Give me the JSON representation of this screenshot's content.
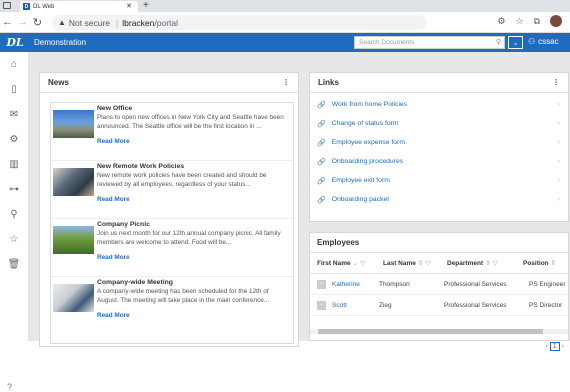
{
  "browser": {
    "tab_title": "DL Web",
    "url_warning": "Not secure",
    "url_host": "lbracken",
    "url_path": "/portal",
    "favicon_text": "D"
  },
  "app": {
    "logo": "DL",
    "title": "Demonstration",
    "search_placeholder": "Search Documents",
    "user": "cssac"
  },
  "news": {
    "title": "News",
    "items": [
      {
        "title": "New Office",
        "body": "Plans to open new offices in New York City and Seattle have been announced. The Seattle office will be the first location in ...",
        "link": "Read More"
      },
      {
        "title": "New Remote Work Policies",
        "body": "New remote work policies have been created and should be reviewed by all employees, regardless of your status...",
        "link": "Read More"
      },
      {
        "title": "Company Picnic",
        "body": "Join us next month for our 12th annual company picnic. All family members are welcome to attend. Food will be...",
        "link": "Read More"
      },
      {
        "title": "Company-wide Meeting",
        "body": "A company-wide meeting has been scheduled for the 12th of August. The meeting will take place in the main conference...",
        "link": "Read More"
      }
    ]
  },
  "links": {
    "title": "Links",
    "items": [
      "Work from home Policies",
      "Change of status form",
      "Employee expense form",
      "Onboarding procedures",
      "Employee exit form",
      "Onboarding packet"
    ]
  },
  "employees": {
    "title": "Employees",
    "columns": [
      "First Name",
      "Last Name",
      "Department",
      "Position"
    ],
    "rows": [
      {
        "first": "Katherine",
        "last": "Thompson",
        "dept": "Professional Services",
        "pos": "PS Engineer"
      },
      {
        "first": "Scott",
        "last": "Zieg",
        "dept": "Professional Services",
        "pos": "PS Director"
      }
    ],
    "page": "1"
  }
}
